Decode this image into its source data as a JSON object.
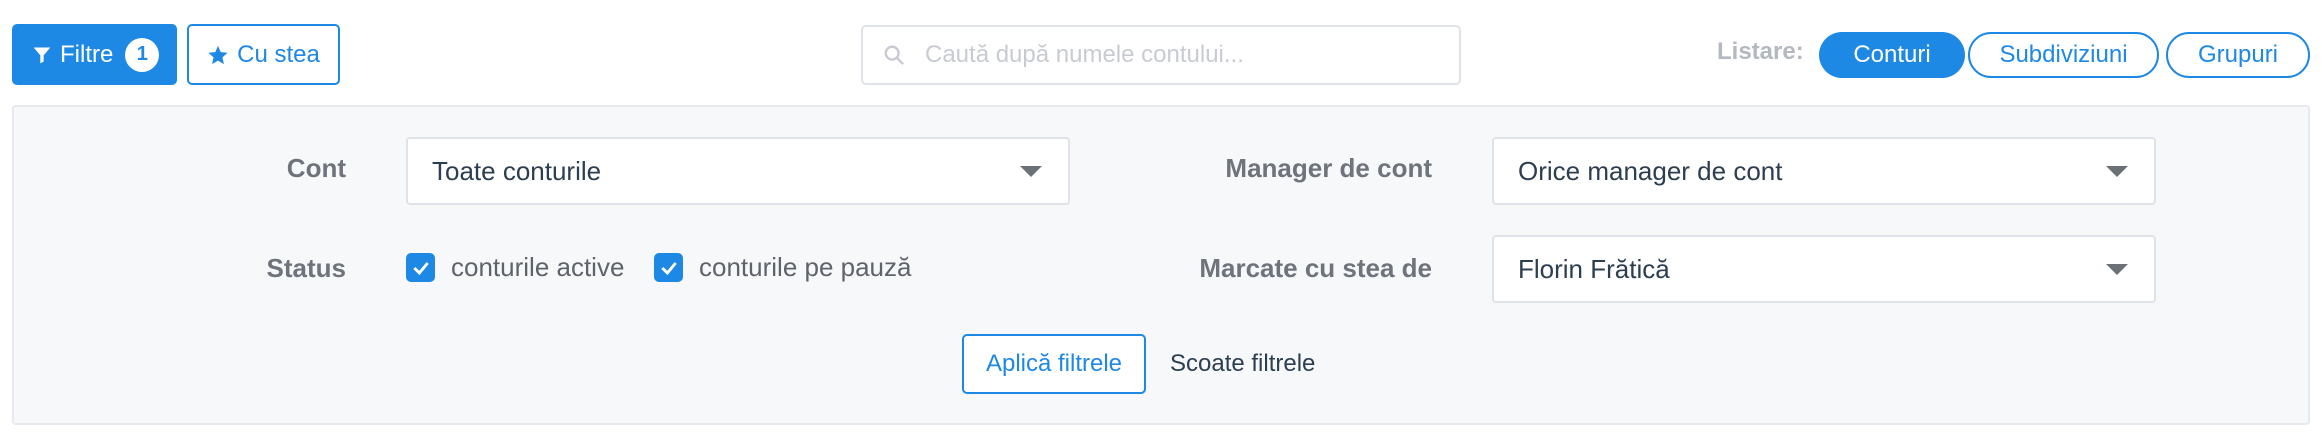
{
  "toolbar": {
    "filters_label": "Filtre",
    "filters_count": "1",
    "starred_label": "Cu stea",
    "search_placeholder": "Caută după numele contului...",
    "listing_label": "Listare:",
    "listing_options": [
      "Conturi",
      "Subdiviziuni",
      "Grupuri"
    ],
    "listing_selected": "Conturi"
  },
  "filters": {
    "account": {
      "label": "Cont",
      "value": "Toate conturile"
    },
    "account_manager": {
      "label": "Manager de cont",
      "value": "Orice manager de cont"
    },
    "status": {
      "label": "Status",
      "options": [
        {
          "label": "conturile active",
          "checked": true
        },
        {
          "label": "conturile pe pauză",
          "checked": true
        }
      ]
    },
    "starred_by": {
      "label": "Marcate cu stea de",
      "value": "Florin Frătică"
    },
    "apply_label": "Aplică filtrele",
    "clear_label": "Scoate filtrele"
  },
  "colors": {
    "primary": "#1e88e5",
    "panel_bg": "#f7f8fa",
    "label_gray": "#6f747c"
  },
  "icons": [
    "filter-icon",
    "star-icon",
    "search-icon",
    "chevron-down-icon",
    "checkmark-icon"
  ]
}
